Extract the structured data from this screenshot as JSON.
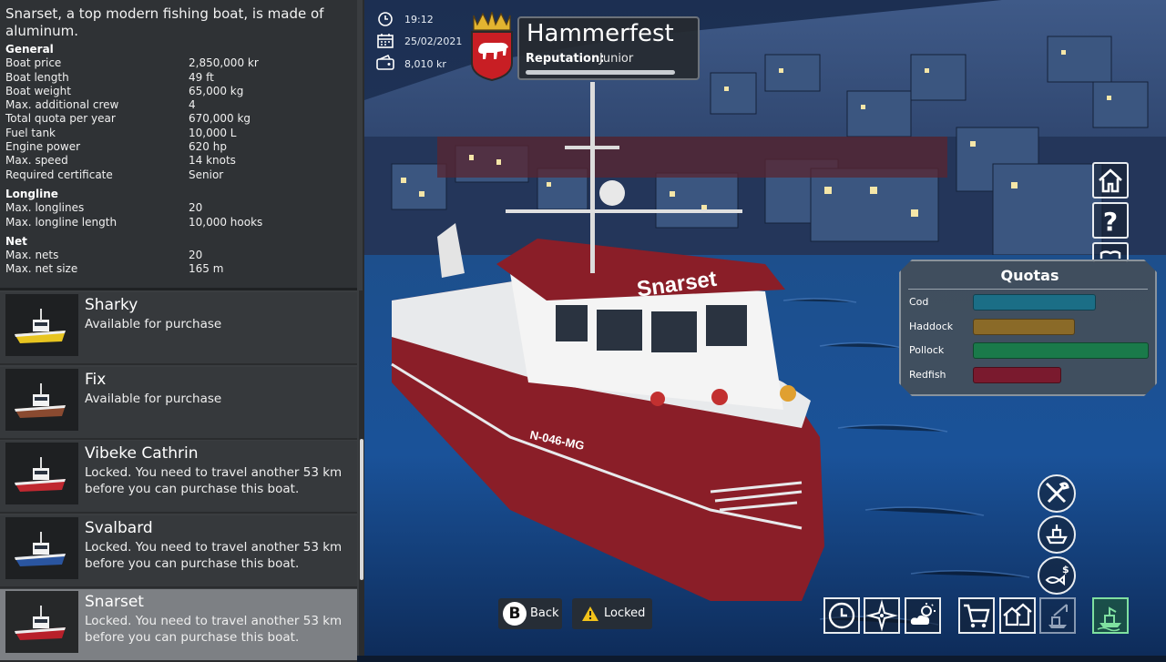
{
  "description": "Snarset, a top modern fishing boat, is made of aluminum.",
  "specs": {
    "general_title": "General",
    "general": [
      {
        "label": "Boat price",
        "value": "2,850,000 kr"
      },
      {
        "label": "Boat length",
        "value": "49 ft"
      },
      {
        "label": "Boat weight",
        "value": "65,000 kg"
      },
      {
        "label": "Max. additional crew",
        "value": "4"
      },
      {
        "label": "Total quota per year",
        "value": "670,000 kg"
      },
      {
        "label": "Fuel tank",
        "value": "10,000 L"
      },
      {
        "label": "Engine power",
        "value": "620 hp"
      },
      {
        "label": "Max. speed",
        "value": "14 knots"
      },
      {
        "label": "Required certificate",
        "value": "Senior"
      }
    ],
    "longline_title": "Longline",
    "longline": [
      {
        "label": "Max. longlines",
        "value": "20"
      },
      {
        "label": "Max. longline length",
        "value": "10,000 hooks"
      }
    ],
    "net_title": "Net",
    "net": [
      {
        "label": "Max. nets",
        "value": "20"
      },
      {
        "label": "Max. net size",
        "value": "165 m"
      }
    ]
  },
  "boats": [
    {
      "name": "Sharky",
      "status": "Available for purchase",
      "hull": "#e8c520"
    },
    {
      "name": "Fix",
      "status": "Available for purchase",
      "hull": "#8a4a30"
    },
    {
      "name": "Vibeke Cathrin",
      "status": "Locked. You need to travel another 53 km before you can purchase this boat.",
      "hull": "#c02830"
    },
    {
      "name": "Svalbard",
      "status": "Locked. You need to travel another 53 km before you can purchase this boat.",
      "hull": "#2a55a0"
    },
    {
      "name": "Snarset",
      "status": "Locked. You need to travel another 53 km before you can purchase this boat.",
      "hull": "#b8202a"
    }
  ],
  "hud": {
    "time": "19:12",
    "date": "25/02/2021",
    "money": "8,010 kr",
    "location": "Hammerfest",
    "reputation_label": "Reputation:",
    "reputation_value": "Junior"
  },
  "boat_hull_name": "Snarset",
  "boat_registration": "N-046-MG",
  "quotas": {
    "title": "Quotas",
    "items": [
      {
        "name": "Cod",
        "fill": 0.7,
        "color": "#1b6e86"
      },
      {
        "name": "Haddock",
        "fill": 0.58,
        "color": "#8a6a28"
      },
      {
        "name": "Pollock",
        "fill": 1.0,
        "color": "#1a7a4a"
      },
      {
        "name": "Redfish",
        "fill": 0.5,
        "color": "#7a1a2e"
      }
    ]
  },
  "buttons": {
    "back_key": "B",
    "back_label": "Back",
    "locked_label": "Locked"
  },
  "colors": {
    "panel": "#3a3d40",
    "selected_row": "#7d8084",
    "water": "#1a4a82",
    "hull_red": "#8a1e28"
  }
}
